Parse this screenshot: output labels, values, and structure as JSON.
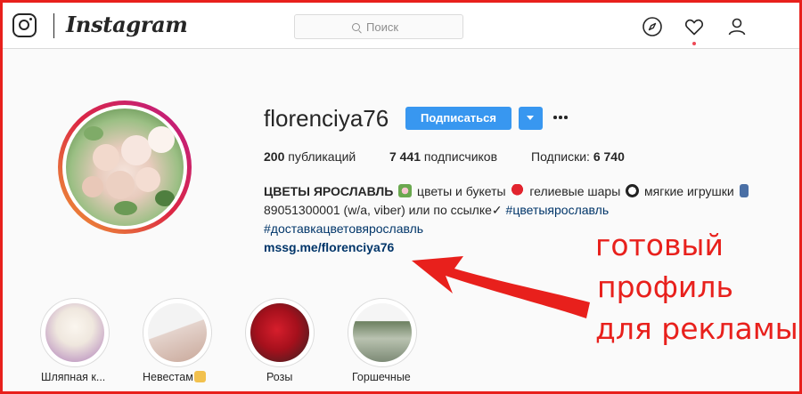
{
  "header": {
    "brand": "Instagram",
    "search_placeholder": "Поиск",
    "icons": [
      "compass-icon",
      "heart-icon",
      "profile-icon"
    ],
    "notification_dot_color": "#ed4956"
  },
  "profile": {
    "username": "florenciya76",
    "follow_label": "Подписаться",
    "stats": {
      "posts_count": "200",
      "posts_label": " публикаций",
      "followers_count": "7 441",
      "followers_label": " подписчиков",
      "following_label": "Подписки: ",
      "following_count": "6 740"
    },
    "bio": {
      "name": "ЦВЕТЫ ЯРОСЛАВЛЬ",
      "line1_a": " цветы и букеты",
      "line1_b": " гелиевые шары",
      "line1_c": " мягкие игрушки",
      "line2_text": "89051300001 (w/a, viber) или по ссылке✓ ",
      "line2_tag": "#цветыярославль",
      "line3_tag": "#доставкацветовярославль",
      "link": "mssg.me/florenciya76"
    }
  },
  "highlights": [
    {
      "label": "Шляпная к..."
    },
    {
      "label": "Невестам",
      "emoji": "bride-emoji-icon"
    },
    {
      "label": "Розы"
    },
    {
      "label": "Горшечные"
    }
  ],
  "annotation": {
    "line1": "готовый",
    "line2": "профиль",
    "line3": "для рекламы",
    "color": "#e8201c"
  },
  "colors": {
    "accent": "#3897f0",
    "frame": "#e8201c",
    "hashtag": "#003569"
  }
}
